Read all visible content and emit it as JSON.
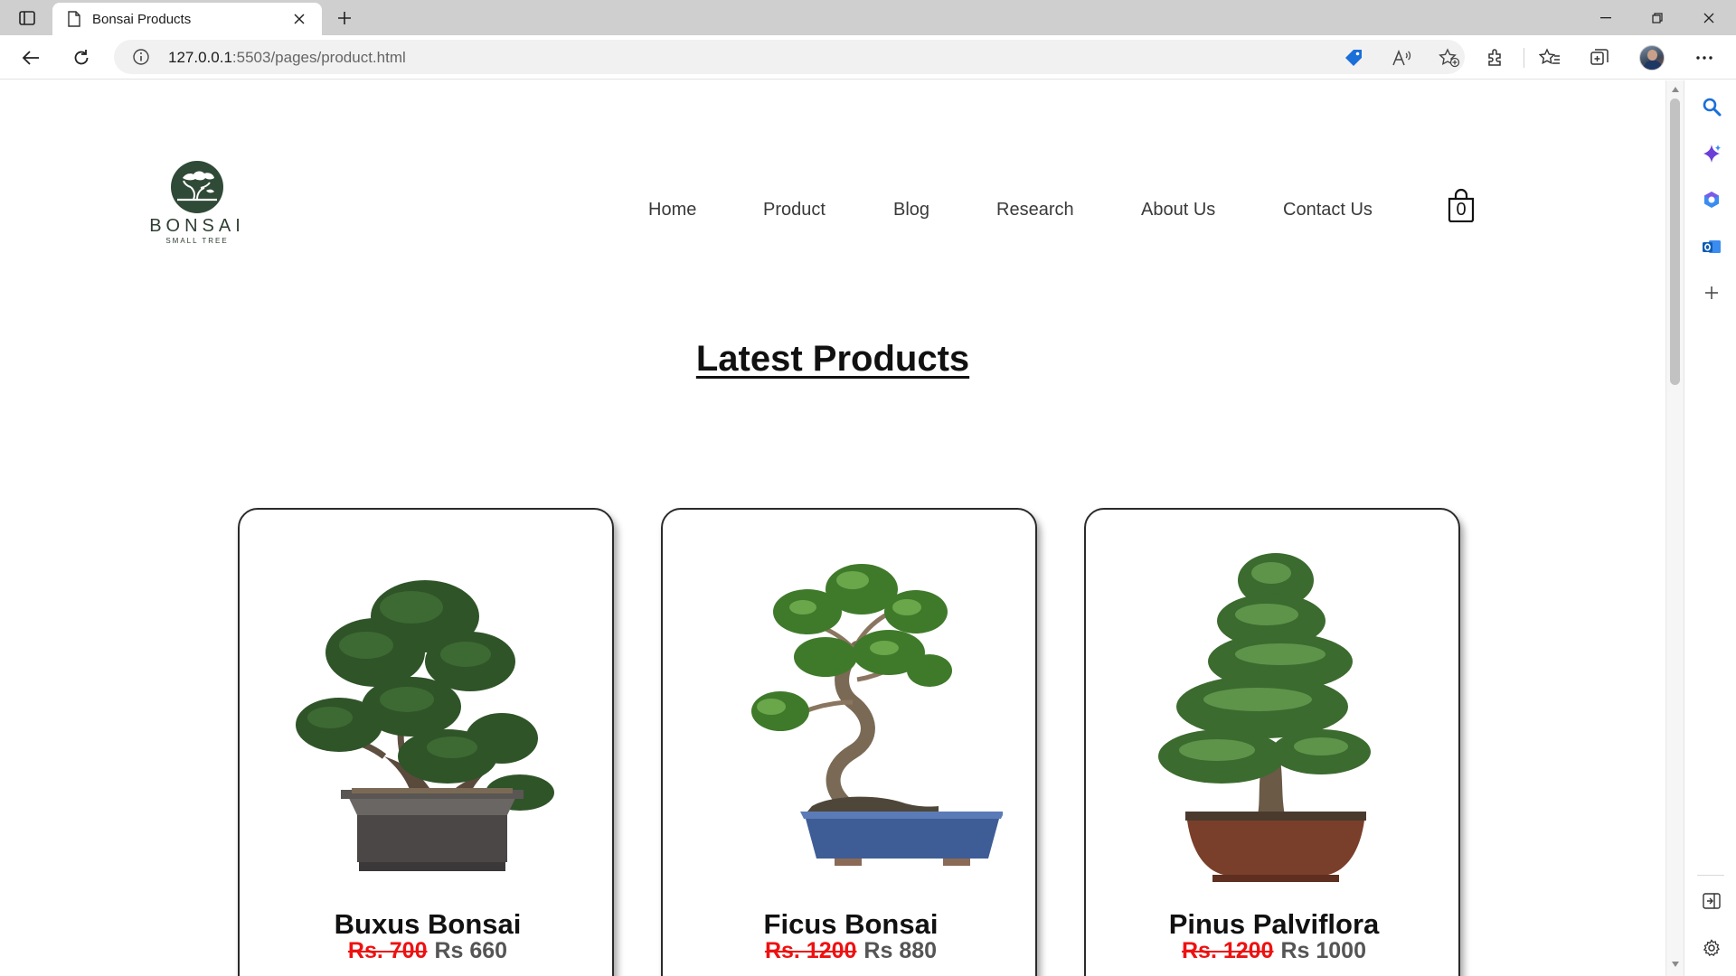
{
  "browser": {
    "tab_title": "Bonsai Products",
    "url_host": "127.0.0.1",
    "url_rest": ":5503/pages/product.html"
  },
  "site": {
    "logo_name": "BONSAI",
    "logo_tagline": "SMALL TREE",
    "nav": [
      "Home",
      "Product",
      "Blog",
      "Research",
      "About Us",
      "Contact Us"
    ],
    "cart_count": "0"
  },
  "section_title": "Latest Products",
  "products": [
    {
      "name": "Buxus Bonsai",
      "old_price": "Rs. 700",
      "price": "Rs 660",
      "pot_color": "#4a4746"
    },
    {
      "name": "Ficus Bonsai",
      "old_price": "Rs. 1200",
      "price": "Rs 880",
      "pot_color": "#3e5d96"
    },
    {
      "name": "Pinus Palviflora",
      "old_price": "Rs. 1200",
      "price": "Rs 1000",
      "pot_color": "#7a3f2a"
    }
  ],
  "colors": {
    "accent_blue": "#1a6fd8",
    "old_price_red": "#ee1111",
    "logo_green": "#2f4a36"
  }
}
